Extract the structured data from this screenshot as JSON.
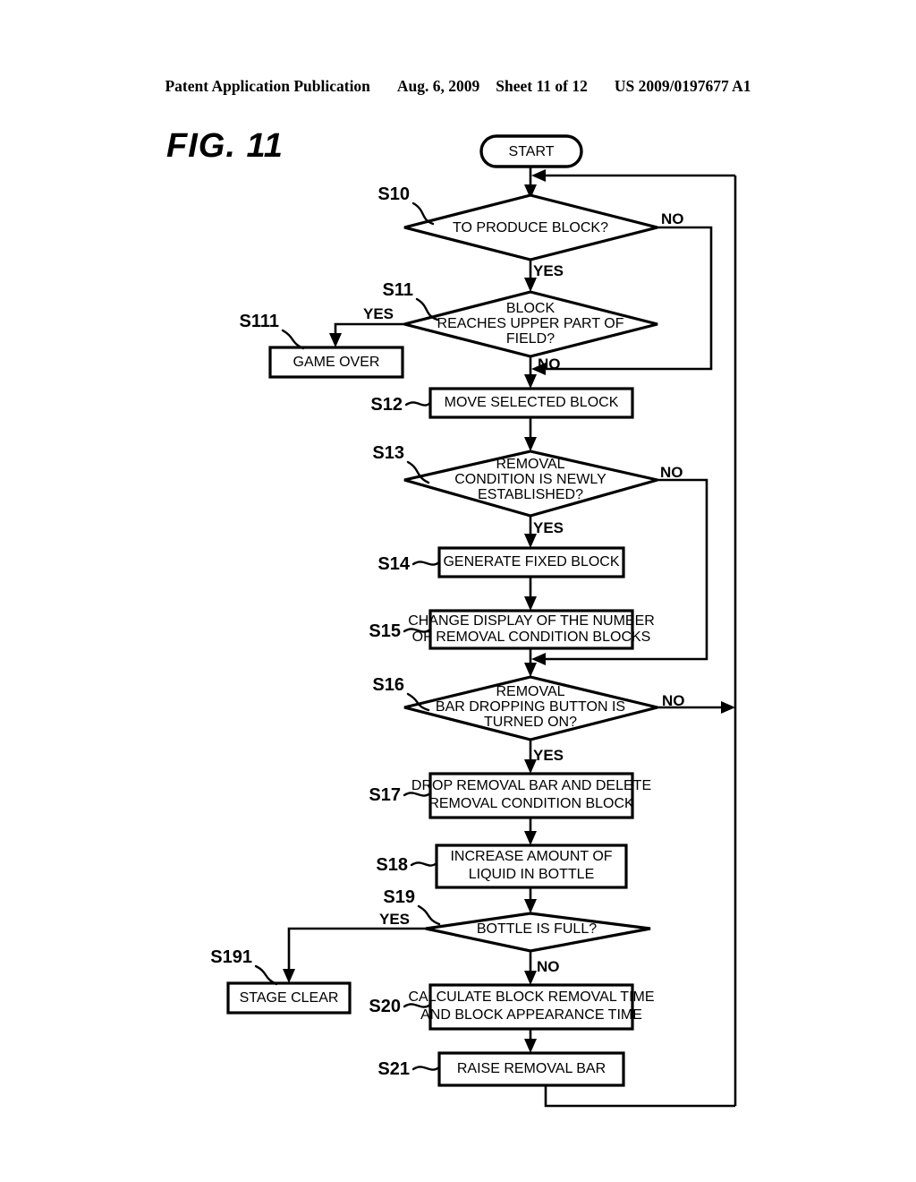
{
  "header": {
    "publication": "Patent Application Publication",
    "date": "Aug. 6, 2009",
    "sheet": "Sheet 11 of 12",
    "number": "US 2009/0197677 A1"
  },
  "figure": {
    "label": "FIG. 11"
  },
  "flowchart": {
    "start_label": "START",
    "branch_labels": {
      "yes": "YES",
      "no": "NO"
    },
    "nodes": [
      {
        "id": "start",
        "step": "",
        "type": "terminator",
        "lines": [
          "START"
        ]
      },
      {
        "id": "s10",
        "step": "S10",
        "type": "decision",
        "lines": [
          "TO PRODUCE BLOCK?"
        ]
      },
      {
        "id": "s11",
        "step": "S11",
        "type": "decision",
        "lines": [
          "BLOCK",
          "REACHES UPPER PART OF",
          "FIELD?"
        ]
      },
      {
        "id": "s111",
        "step": "S111",
        "type": "process",
        "lines": [
          "GAME OVER"
        ]
      },
      {
        "id": "s12",
        "step": "S12",
        "type": "process",
        "lines": [
          "MOVE SELECTED BLOCK"
        ]
      },
      {
        "id": "s13",
        "step": "S13",
        "type": "decision",
        "lines": [
          "REMOVAL",
          "CONDITION IS NEWLY",
          "ESTABLISHED?"
        ]
      },
      {
        "id": "s14",
        "step": "S14",
        "type": "process",
        "lines": [
          "GENERATE FIXED BLOCK"
        ]
      },
      {
        "id": "s15",
        "step": "S15",
        "type": "process",
        "lines": [
          "CHANGE DISPLAY OF THE NUMBER",
          "OF REMOVAL CONDITION BLOCKS"
        ]
      },
      {
        "id": "s16",
        "step": "S16",
        "type": "decision",
        "lines": [
          "REMOVAL",
          "BAR DROPPING BUTTON IS",
          "TURNED ON?"
        ]
      },
      {
        "id": "s17",
        "step": "S17",
        "type": "process",
        "lines": [
          "DROP REMOVAL BAR AND DELETE",
          "REMOVAL CONDITION BLOCK"
        ]
      },
      {
        "id": "s18",
        "step": "S18",
        "type": "process",
        "lines": [
          "INCREASE AMOUNT OF",
          "LIQUID IN BOTTLE"
        ]
      },
      {
        "id": "s19",
        "step": "S19",
        "type": "decision",
        "lines": [
          "BOTTLE IS FULL?"
        ]
      },
      {
        "id": "s191",
        "step": "S191",
        "type": "process",
        "lines": [
          "STAGE CLEAR"
        ]
      },
      {
        "id": "s20",
        "step": "S20",
        "type": "process",
        "lines": [
          "CALCULATE BLOCK REMOVAL TIME",
          "AND BLOCK APPEARANCE TIME"
        ]
      },
      {
        "id": "s21",
        "step": "S21",
        "type": "process",
        "lines": [
          "RAISE REMOVAL BAR"
        ]
      }
    ],
    "edges": [
      {
        "from": "start",
        "to": "s10",
        "label": ""
      },
      {
        "from": "s10",
        "to": "s11",
        "label": "YES"
      },
      {
        "from": "s10",
        "to": "s11",
        "label": "NO"
      },
      {
        "from": "s11",
        "to": "s111",
        "label": "YES"
      },
      {
        "from": "s11",
        "to": "s12",
        "label": "NO"
      },
      {
        "from": "s12",
        "to": "s13",
        "label": ""
      },
      {
        "from": "s13",
        "to": "s14",
        "label": "YES"
      },
      {
        "from": "s13",
        "to": "s16",
        "label": "NO"
      },
      {
        "from": "s14",
        "to": "s15",
        "label": ""
      },
      {
        "from": "s15",
        "to": "s16",
        "label": ""
      },
      {
        "from": "s16",
        "to": "s17",
        "label": "YES"
      },
      {
        "from": "s16",
        "to": "start",
        "label": "NO"
      },
      {
        "from": "s17",
        "to": "s18",
        "label": ""
      },
      {
        "from": "s18",
        "to": "s19",
        "label": ""
      },
      {
        "from": "s19",
        "to": "s191",
        "label": "YES"
      },
      {
        "from": "s19",
        "to": "s20",
        "label": "NO"
      },
      {
        "from": "s20",
        "to": "s21",
        "label": ""
      },
      {
        "from": "s21",
        "to": "start",
        "label": ""
      }
    ]
  },
  "colors": {
    "ink": "#000000",
    "paper": "#ffffff"
  }
}
